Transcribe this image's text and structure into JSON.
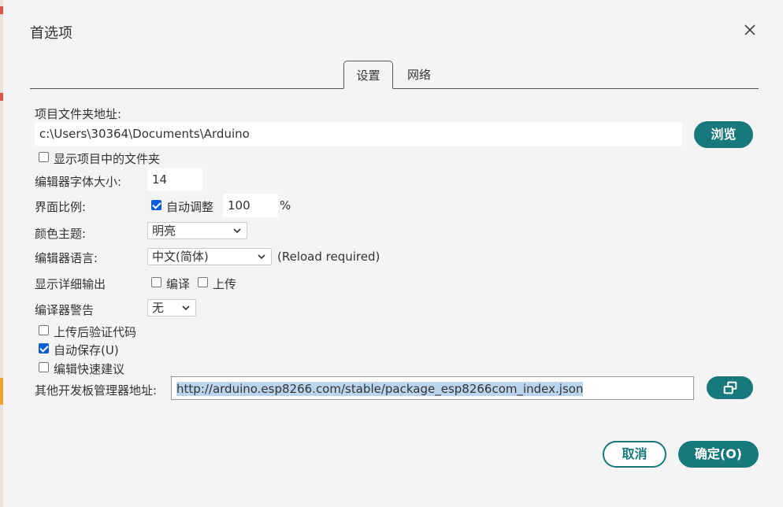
{
  "dialog": {
    "title": "首选项",
    "tabs": [
      {
        "label": "设置",
        "active": true
      },
      {
        "label": "网络",
        "active": false
      }
    ]
  },
  "settings": {
    "sketchbook_label": "项目文件夹地址:",
    "sketchbook_path": "c:\\Users\\30364\\Documents\\Arduino",
    "browse_label": "浏览",
    "show_sketch_files_label": "显示项目中的文件夹",
    "show_sketch_files_checked": false,
    "font_size_label": "编辑器字体大小:",
    "font_size_value": "14",
    "scale_label": "界面比例:",
    "auto_scale_label": "自动调整",
    "auto_scale_checked": true,
    "scale_value": "100",
    "scale_unit": "%",
    "theme_label": "颜色主题:",
    "theme_value": "明亮",
    "language_label": "编辑器语言:",
    "language_value": "中文(简体)",
    "language_note": "(Reload required)",
    "verbose_label": "显示详细输出",
    "verbose_compile_label": "编译",
    "verbose_compile_checked": false,
    "verbose_upload_label": "上传",
    "verbose_upload_checked": false,
    "compiler_warnings_label": "编译器警告",
    "compiler_warnings_value": "无",
    "verify_after_upload_label": "上传后验证代码",
    "verify_after_upload_checked": false,
    "auto_save_label": "自动保存(U)",
    "auto_save_checked": true,
    "quick_suggestions_label": "编辑快速建议",
    "quick_suggestions_checked": false,
    "board_urls_label": "其他开发板管理器地址:",
    "board_urls_value": "http://arduino.esp8266.com/stable/package_esp8266com_index.json"
  },
  "footer": {
    "cancel_label": "取消",
    "ok_label": "确定(O)"
  },
  "colors": {
    "accent": "#17797c",
    "checkbox_checked": "#0b5cd8",
    "selection_highlight": "#bcd5ee"
  }
}
